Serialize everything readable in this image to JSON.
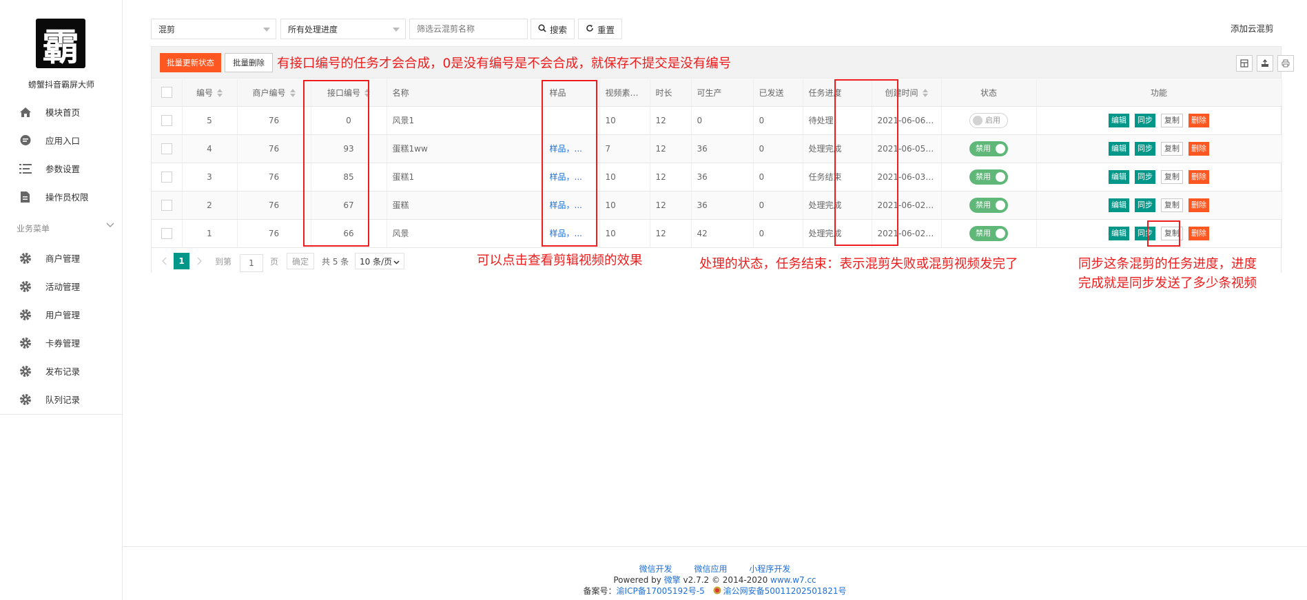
{
  "brand": {
    "logo_char": "霸",
    "app_name": "螃蟹抖音霸屏大师"
  },
  "sidebar": {
    "items": [
      {
        "label": "模块首页",
        "icon": "home-icon"
      },
      {
        "label": "应用入口",
        "icon": "chat-icon"
      },
      {
        "label": "参数设置",
        "icon": "list-icon"
      },
      {
        "label": "操作员权限",
        "icon": "document-icon"
      }
    ],
    "section_label": "业务菜单",
    "business_items": [
      {
        "label": "商户管理",
        "icon": "gear-icon"
      },
      {
        "label": "活动管理",
        "icon": "gear-icon"
      },
      {
        "label": "用户管理",
        "icon": "gear-icon"
      },
      {
        "label": "卡券管理",
        "icon": "gear-icon"
      },
      {
        "label": "发布记录",
        "icon": "gear-icon"
      },
      {
        "label": "队列记录",
        "icon": "gear-icon"
      }
    ]
  },
  "filters": {
    "type_value": "混剪",
    "progress_value": "所有处理进度",
    "search_placeholder": "筛选云混剪名称",
    "search_label": "搜索",
    "reset_label": "重置",
    "add_label": "添加云混剪"
  },
  "toolbar": {
    "batch_update_label": "批量更新状态",
    "batch_delete_label": "批量删除"
  },
  "table": {
    "headers": {
      "id": "编号",
      "merchant": "商户编号",
      "api_id": "接口编号",
      "name": "名称",
      "sample": "样品",
      "video_count": "视频素材数",
      "duration": "时长",
      "producible": "可生产",
      "sent": "已发送",
      "progress": "任务进度",
      "created": "创建时间",
      "status": "状态",
      "actions": "功能"
    },
    "rows": [
      {
        "id": "5",
        "merchant": "76",
        "api_id": "0",
        "name": "风景1",
        "sample": "",
        "video_count": "10",
        "duration": "12",
        "producible": "0",
        "sent": "0",
        "progress": "待处理",
        "created": "2021-06-06 ...",
        "status": "启用",
        "status_on": false
      },
      {
        "id": "4",
        "merchant": "76",
        "api_id": "93",
        "name": "蛋糕1ww",
        "sample": "样品，...",
        "video_count": "7",
        "duration": "12",
        "producible": "36",
        "sent": "0",
        "progress": "处理完成",
        "created": "2021-06-05 ...",
        "status": "禁用",
        "status_on": true
      },
      {
        "id": "3",
        "merchant": "76",
        "api_id": "85",
        "name": "蛋糕1",
        "sample": "样品，...",
        "video_count": "10",
        "duration": "12",
        "producible": "36",
        "sent": "0",
        "progress": "任务结束",
        "created": "2021-06-03 ...",
        "status": "禁用",
        "status_on": true
      },
      {
        "id": "2",
        "merchant": "76",
        "api_id": "67",
        "name": "蛋糕",
        "sample": "样品，...",
        "video_count": "10",
        "duration": "12",
        "producible": "36",
        "sent": "0",
        "progress": "处理完成",
        "created": "2021-06-02 ...",
        "status": "禁用",
        "status_on": true
      },
      {
        "id": "1",
        "merchant": "76",
        "api_id": "66",
        "name": "风景",
        "sample": "样品，...",
        "video_count": "10",
        "duration": "12",
        "producible": "42",
        "sent": "0",
        "progress": "处理完成",
        "created": "2021-06-02 ...",
        "status": "禁用",
        "status_on": true
      }
    ],
    "actions": {
      "edit": "编辑",
      "sync": "同步",
      "copy": "复制",
      "delete": "删除"
    }
  },
  "pager": {
    "current": "1",
    "goto_label": "到第",
    "page_input": "1",
    "page_unit": "页",
    "confirm_label": "确定",
    "total": "共 5 条",
    "page_size": "10 条/页"
  },
  "annotations": {
    "top": "有接口编号的任务才会合成，0是没有编号是不会合成，就保存不提交是没有编号",
    "sample": "可以点击查看剪辑视频的效果",
    "progress": "处理的状态，任务结束：表示混剪失败或混剪视频发完了",
    "sync_line1": "同步这条混剪的任务进度，进度",
    "sync_line2": "完成就是同步发送了多少条视频"
  },
  "footer": {
    "links": [
      "微信开发",
      "微信应用",
      "小程序开发"
    ],
    "powered_prefix": "Powered by ",
    "powered_brand": "微擎",
    "powered_version": " v2.7.2 © 2014-2020 ",
    "powered_site": "www.w7.cc",
    "record_label": "备案号：",
    "icp": "渝ICP备17005192号-5",
    "police": "渝公网安备50011202501821号"
  },
  "colors": {
    "accent_green": "#009688",
    "accent_orange": "#ff5722",
    "annotation_red": "#ee1c1c",
    "switch_green": "#5fb878"
  }
}
